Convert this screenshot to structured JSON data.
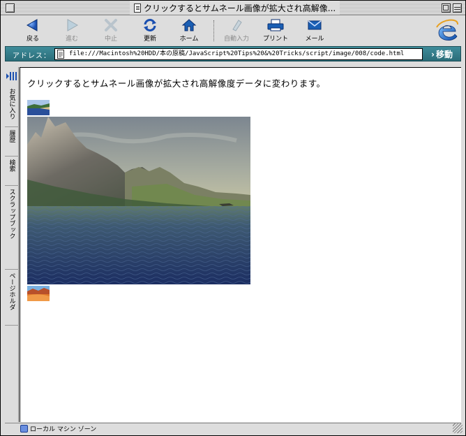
{
  "window": {
    "title": "クリックするとサムネール画像が拡大され高解像..."
  },
  "toolbar": {
    "buttons": [
      {
        "label": "戻る",
        "icon": "back-arrow-icon",
        "enabled": true
      },
      {
        "label": "進む",
        "icon": "forward-arrow-icon",
        "enabled": false
      },
      {
        "label": "中止",
        "icon": "stop-x-icon",
        "enabled": false
      },
      {
        "label": "更新",
        "icon": "refresh-icon",
        "enabled": true
      },
      {
        "label": "ホーム",
        "icon": "home-icon",
        "enabled": true
      },
      {
        "label": "自動入力",
        "icon": "autofill-pen-icon",
        "enabled": false
      },
      {
        "label": "プリント",
        "icon": "printer-icon",
        "enabled": true
      },
      {
        "label": "メール",
        "icon": "mail-envelope-icon",
        "enabled": true
      }
    ]
  },
  "address": {
    "label": "アドレス：",
    "url": "file:///Macintosh%20HDD/本の原稿/JavaScript%20Tips%20&%20Tricks/script/image/008/code.html",
    "go_label": "移動"
  },
  "sidebar": {
    "tabs": [
      "お気に入り",
      "履歴",
      "検索",
      "スクラップブック",
      "ページホルダ"
    ]
  },
  "content": {
    "instruction": "クリックするとサムネール画像が拡大され高解像度データに変わります。"
  },
  "status": {
    "zone": "ローカル マシン ゾーン"
  },
  "colors": {
    "address_bar": "#2f7884",
    "accent_blue": "#1a5fb4"
  }
}
